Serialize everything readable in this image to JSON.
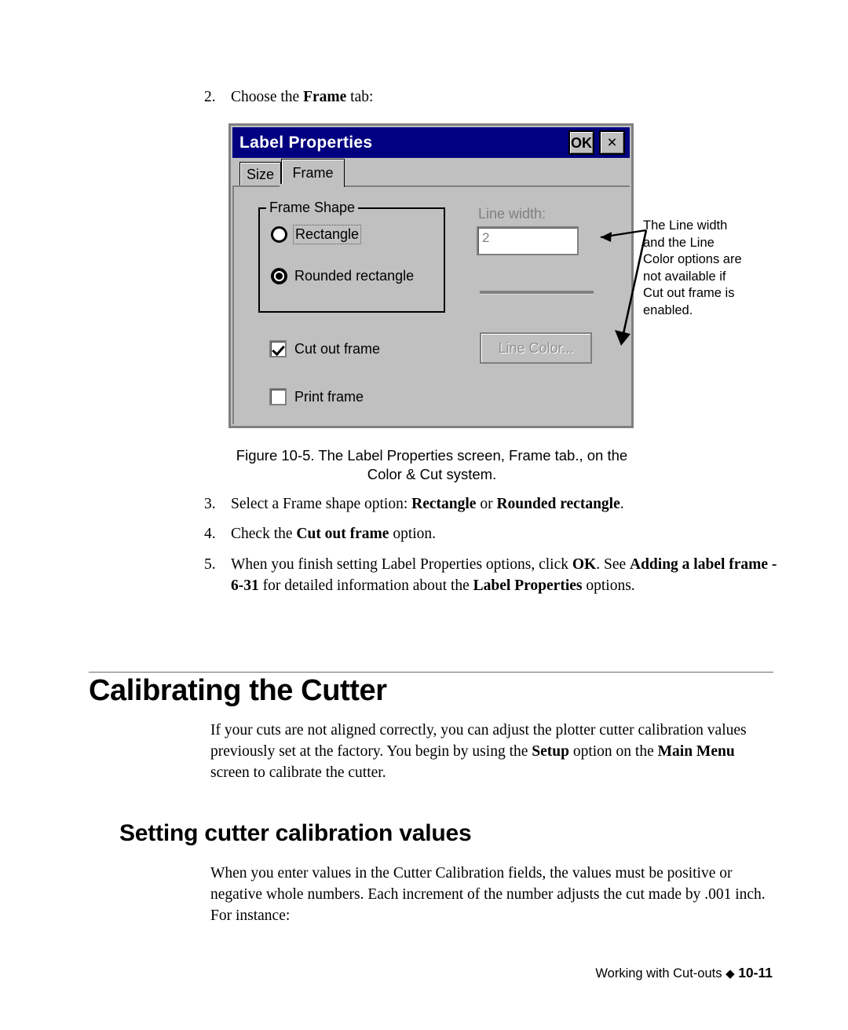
{
  "steps": [
    {
      "num": "2.",
      "parts": [
        {
          "t": "Choose the ",
          "b": false
        },
        {
          "t": "Frame",
          "b": true
        },
        {
          "t": " tab:",
          "b": false
        }
      ]
    },
    {
      "num": "3.",
      "parts": [
        {
          "t": "Select a Frame shape option: ",
          "b": false
        },
        {
          "t": "Rectangle",
          "b": true
        },
        {
          "t": " or ",
          "b": false
        },
        {
          "t": "Rounded rectangle",
          "b": true
        },
        {
          "t": ".",
          "b": false
        }
      ]
    },
    {
      "num": "4.",
      "parts": [
        {
          "t": "Check the ",
          "b": false
        },
        {
          "t": "Cut out frame",
          "b": true
        },
        {
          "t": " option.",
          "b": false
        }
      ]
    },
    {
      "num": "5.",
      "parts": [
        {
          "t": "When you finish setting Label Properties options, click ",
          "b": false
        },
        {
          "t": "OK",
          "b": true
        },
        {
          "t": ". See ",
          "b": false
        },
        {
          "t": "Adding a label frame - 6-31",
          "b": true
        },
        {
          "t": " for detailed information about the ",
          "b": false
        },
        {
          "t": "Label Properties",
          "b": true
        },
        {
          "t": " options.",
          "b": false
        }
      ]
    }
  ],
  "dialog": {
    "title": "Label Properties",
    "ok_label": "OK",
    "close_label": "×",
    "tabs": [
      {
        "label": "Size",
        "active": false
      },
      {
        "label": "Frame",
        "active": true
      }
    ],
    "group_shape": {
      "title": "Frame Shape",
      "options": [
        {
          "label": "Rectangle",
          "checked": false,
          "focused": true
        },
        {
          "label": "Rounded rectangle",
          "checked": true,
          "focused": false
        }
      ]
    },
    "checkboxes": [
      {
        "label": "Cut out frame",
        "checked": true
      },
      {
        "label": "Print frame",
        "checked": false
      }
    ],
    "line_width": {
      "label": "Line width:",
      "value": "2"
    },
    "line_color_button": {
      "label": "Line Color..."
    },
    "colors": {
      "titlebar": "#000080",
      "face": "#c0c0c0",
      "border": "#808080",
      "field": "#ffffff",
      "disabled_text": "#808080"
    }
  },
  "callout": {
    "text": "The Line width and the Line Color options are not available if Cut out frame is enabled."
  },
  "figure_caption": {
    "line1": "Figure 10-5. The Label Properties screen, Frame tab., on the",
    "line2": "Color & Cut system."
  },
  "headings": {
    "h1": "Calibrating the Cutter",
    "h2": "Setting cutter calibration values"
  },
  "paragraphs": {
    "calibrating": [
      {
        "t": "If your cuts are not aligned correctly, you can adjust the plotter cutter calibration values previously set at the factory. You begin by using the ",
        "b": false
      },
      {
        "t": "Setup",
        "b": true
      },
      {
        "t": " option on the ",
        "b": false
      },
      {
        "t": "Main Menu",
        "b": true
      },
      {
        "t": " screen to calibrate the cutter.",
        "b": false
      }
    ],
    "setting": [
      {
        "t": "When you enter values in the Cutter Calibration fields, the values must be positive or negative whole numbers. Each increment of the number adjusts the cut made by .001 inch. For instance:",
        "b": false
      }
    ]
  },
  "footer": {
    "text": "Working with Cut-outs",
    "diamond": "◆",
    "page": "10-11"
  }
}
